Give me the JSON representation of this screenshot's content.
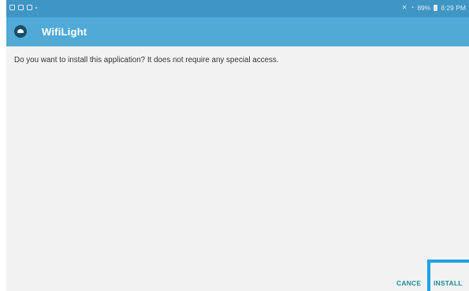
{
  "status_bar": {
    "left_icons": [
      "notification-icon",
      "screen-icon",
      "image-icon",
      "dot-icon"
    ],
    "right_icons": [
      "mute-icon",
      "wifi-icon",
      "battery-icon"
    ],
    "battery": "89%",
    "time": "8:29 PM",
    "colors": {
      "background": "#3f95c4",
      "text": "#dbeaf4"
    }
  },
  "app_bar": {
    "icon": "android-icon",
    "title": "WifiLight",
    "background": "#51aad6"
  },
  "content": {
    "message": "Do you want to install this application? It does not require any special access."
  },
  "actions": {
    "cancel_label": "CANCE",
    "install_label": "INSTALL",
    "accent": "#1f8a96",
    "highlight": "#1ba2e6"
  }
}
